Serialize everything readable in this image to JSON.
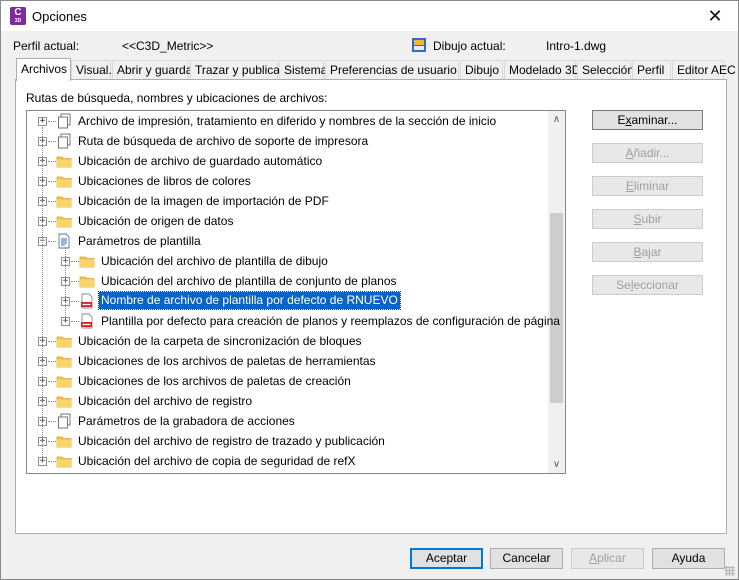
{
  "window": {
    "title": "Opciones",
    "close_glyph": "✕"
  },
  "header": {
    "profile_label": "Perfil actual:",
    "profile_value": "<<C3D_Metric>>",
    "drawing_label": "Dibujo actual:",
    "drawing_value": "Intro-1.dwg"
  },
  "tabs": [
    {
      "label": "Archivos",
      "active": true
    },
    {
      "label": "Visual."
    },
    {
      "label": "Abrir y guardar"
    },
    {
      "label": "Trazar y publicar"
    },
    {
      "label": "Sistema"
    },
    {
      "label": "Preferencias de usuario"
    },
    {
      "label": "Dibujo"
    },
    {
      "label": "Modelado 3D"
    },
    {
      "label": "Selección"
    },
    {
      "label": "Perfil"
    },
    {
      "label": "Editor AEC"
    }
  ],
  "panel": {
    "label": "Rutas de búsqueda, nombres y ubicaciones de archivos:"
  },
  "tree": {
    "items": [
      {
        "label": "Archivo de impresión, tratamiento en diferido y nombres de la sección de inicio",
        "icon": "files-icon",
        "level": 0,
        "expander": "+"
      },
      {
        "label": "Ruta de búsqueda de archivo de soporte de impresora",
        "icon": "files-icon",
        "level": 0,
        "expander": "+"
      },
      {
        "label": "Ubicación de archivo de guardado automático",
        "icon": "folder-icon",
        "level": 0,
        "expander": "+"
      },
      {
        "label": "Ubicaciones de libros de colores",
        "icon": "folder-icon",
        "level": 0,
        "expander": "+"
      },
      {
        "label": "Ubicación de la imagen de importación de PDF",
        "icon": "folder-icon",
        "level": 0,
        "expander": "+"
      },
      {
        "label": "Ubicación de origen de datos",
        "icon": "folder-icon",
        "level": 0,
        "expander": "+"
      },
      {
        "label": "Parámetros de plantilla",
        "icon": "template-icon",
        "level": 0,
        "expander": "−"
      },
      {
        "label": "Ubicación del archivo de plantilla de dibujo",
        "icon": "folder-icon",
        "level": 1,
        "expander": "+"
      },
      {
        "label": "Ubicación del archivo de plantilla de conjunto de planos",
        "icon": "folder-icon",
        "level": 1,
        "expander": "+"
      },
      {
        "label": "Nombre de archivo de plantilla por defecto de RNUEVO",
        "icon": "dwt-icon",
        "level": 1,
        "expander": "+",
        "selected": true
      },
      {
        "label": "Plantilla por defecto para creación de planos y reemplazos de configuración de página",
        "icon": "dwt-icon",
        "level": 1,
        "expander": "+"
      },
      {
        "label": "Ubicación de la carpeta de sincronización de bloques",
        "icon": "folder-icon",
        "level": 0,
        "expander": "+"
      },
      {
        "label": "Ubicaciones de los archivos de paletas de herramientas",
        "icon": "folder-icon",
        "level": 0,
        "expander": "+"
      },
      {
        "label": "Ubicaciones de los archivos de paletas de creación",
        "icon": "folder-icon",
        "level": 0,
        "expander": "+"
      },
      {
        "label": "Ubicación del archivo de registro",
        "icon": "folder-icon",
        "level": 0,
        "expander": "+"
      },
      {
        "label": "Parámetros de la grabadora de acciones",
        "icon": "files-icon",
        "level": 0,
        "expander": "+"
      },
      {
        "label": "Ubicación del archivo de registro de trazado y publicación",
        "icon": "folder-icon",
        "level": 0,
        "expander": "+"
      },
      {
        "label": "Ubicación del archivo de copia de seguridad de refX",
        "icon": "folder-icon",
        "level": 0,
        "expander": "+"
      }
    ],
    "scroll_up_glyph": "∧",
    "scroll_down_glyph": "∨"
  },
  "side_buttons": [
    {
      "name": "examinar-button",
      "pre": "E",
      "key": "x",
      "post": "aminar...",
      "disabled": false
    },
    {
      "name": "anadir-button",
      "pre": "",
      "key": "A",
      "post": "ñadir...",
      "disabled": true
    },
    {
      "name": "eliminar-button",
      "pre": "",
      "key": "E",
      "post": "liminar",
      "disabled": true
    },
    {
      "name": "subir-button",
      "pre": "",
      "key": "S",
      "post": "ubir",
      "disabled": true
    },
    {
      "name": "bajar-button",
      "pre": "",
      "key": "B",
      "post": "ajar",
      "disabled": true
    },
    {
      "name": "seleccionar-button",
      "pre": "Se",
      "key": "l",
      "post": "eccionar",
      "disabled": true
    }
  ],
  "bottom_buttons": {
    "accept": "Aceptar",
    "cancel": "Cancelar",
    "apply_key": "A",
    "apply_rest": "plicar",
    "help": "Ayuda"
  },
  "colors": {
    "selection": "#0a64c8",
    "folder": "#f4c44a",
    "app_icon": "#7b2b9b"
  }
}
